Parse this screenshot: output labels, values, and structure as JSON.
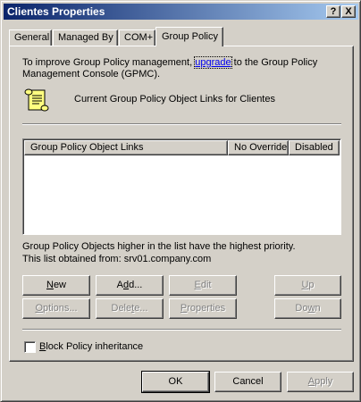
{
  "window": {
    "title": "Clientes Properties",
    "help_label": "?",
    "close_label": "X"
  },
  "tabs": [
    {
      "label": "General"
    },
    {
      "label": "Managed By"
    },
    {
      "label": "COM+"
    },
    {
      "label": "Group Policy",
      "active": true
    }
  ],
  "gpmc_notice": {
    "line1_prefix": "To improve Group Policy management,",
    "link": "upgrade",
    "line1_suffix": "to the Group Policy",
    "line2": "Management Console (GPMC)."
  },
  "gpo_title": "Current Group Policy Object Links for Clientes",
  "list": {
    "columns": [
      "Group Policy Object Links",
      "No Override",
      "Disabled"
    ],
    "rows": []
  },
  "info": {
    "priority_note": "Group Policy Objects higher in the list have the highest priority.",
    "obtained_from": "This list obtained from: srv01.company.com"
  },
  "buttons": {
    "new": {
      "key": "N",
      "rest": "ew"
    },
    "add": {
      "key": "d",
      "pre": "A",
      "rest": "d..."
    },
    "edit": {
      "key": "E",
      "rest": "dit"
    },
    "up": {
      "key": "U",
      "rest": "p"
    },
    "options": {
      "key": "O",
      "rest": "ptions..."
    },
    "delete": {
      "key": "t",
      "pre": "Dele",
      "rest": "e..."
    },
    "properties": {
      "key": "P",
      "rest": "roperties"
    },
    "down": {
      "key": "w",
      "pre": "Do",
      "rest": "n"
    }
  },
  "block_inheritance": {
    "key": "B",
    "rest": "lock Policy inheritance",
    "checked": false
  },
  "dialog": {
    "ok": "OK",
    "cancel": "Cancel",
    "apply": {
      "key": "A",
      "rest": "pply"
    }
  },
  "colors": {
    "titlebar_start": "#0a246a",
    "titlebar_end": "#a6caf0",
    "face": "#d4d0c8",
    "link": "#0000ee",
    "disabled_text": "#808080"
  },
  "icons": [
    "scroll-icon",
    "checkbox-icon"
  ]
}
